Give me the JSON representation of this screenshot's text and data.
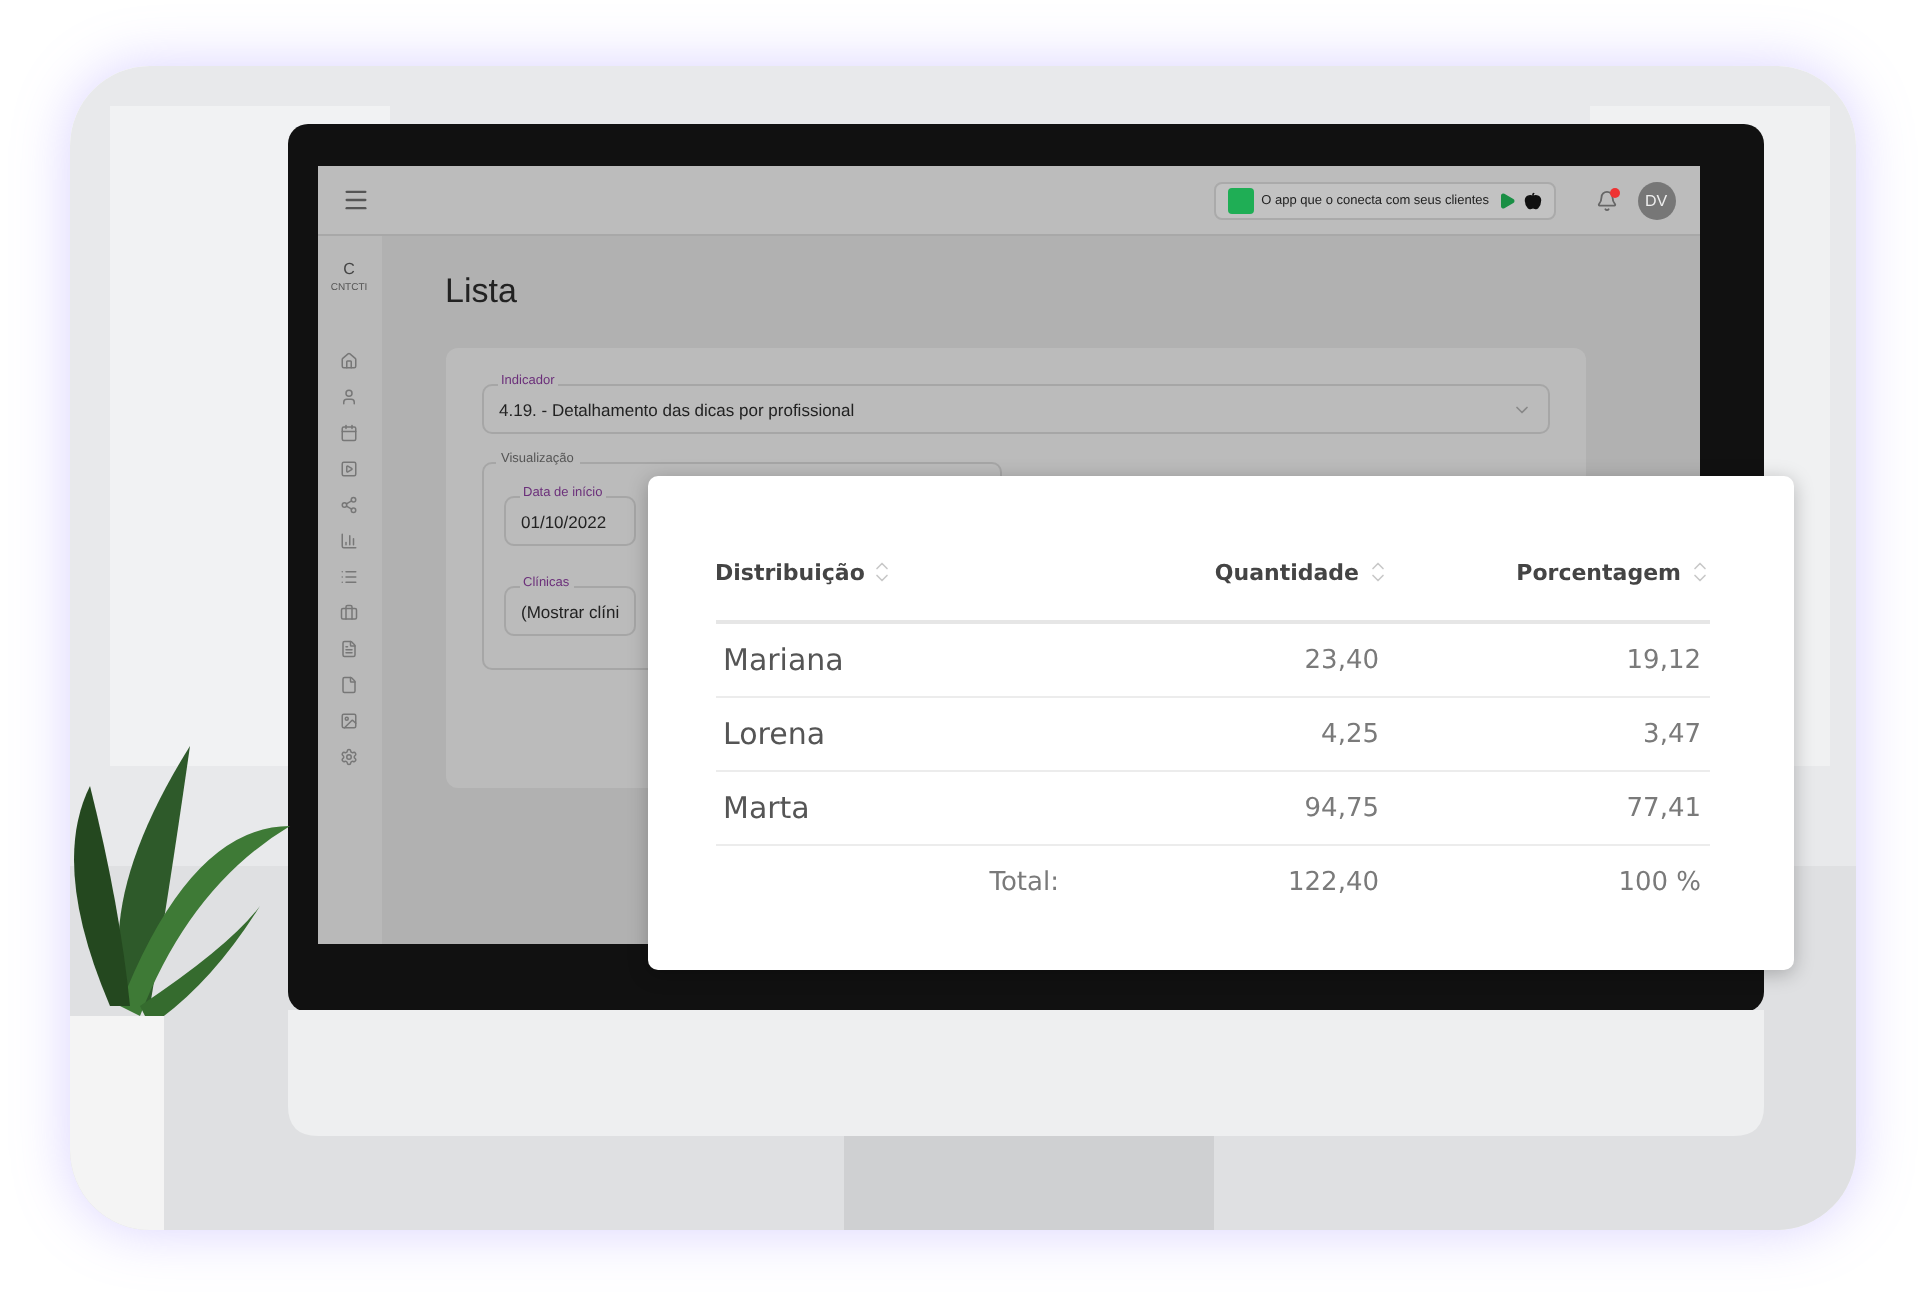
{
  "screen": {
    "topbar": {
      "promo": "O app que o conecta com seus clientes",
      "notification": true,
      "avatar": "DV"
    },
    "sidebar": {
      "logo": "C",
      "brand": "CNTCTI"
    },
    "page_title": "Lista",
    "indicator": {
      "label": "Indicador",
      "value": "4.19. - Detalhamento das dicas por profissional"
    },
    "visualization": {
      "legend": "Visualização",
      "fields": [
        {
          "label": "Data de início",
          "value": "01/10/2022"
        },
        {
          "label": "Clínicas",
          "value": "(Mostrar clíni"
        }
      ]
    }
  },
  "table": {
    "columns": [
      "Distribuição",
      "Quantidade",
      "Porcentagem"
    ],
    "rows": [
      {
        "name": "Mariana",
        "quantidade": "23,40",
        "porcentagem": "19,12"
      },
      {
        "name": "Lorena",
        "quantidade": "4,25",
        "porcentagem": "3,47"
      },
      {
        "name": "Marta",
        "quantidade": "94,75",
        "porcentagem": "77,41"
      }
    ],
    "total": {
      "label": "Total:",
      "quantidade": "122,40",
      "porcentagem": "100 %"
    }
  }
}
